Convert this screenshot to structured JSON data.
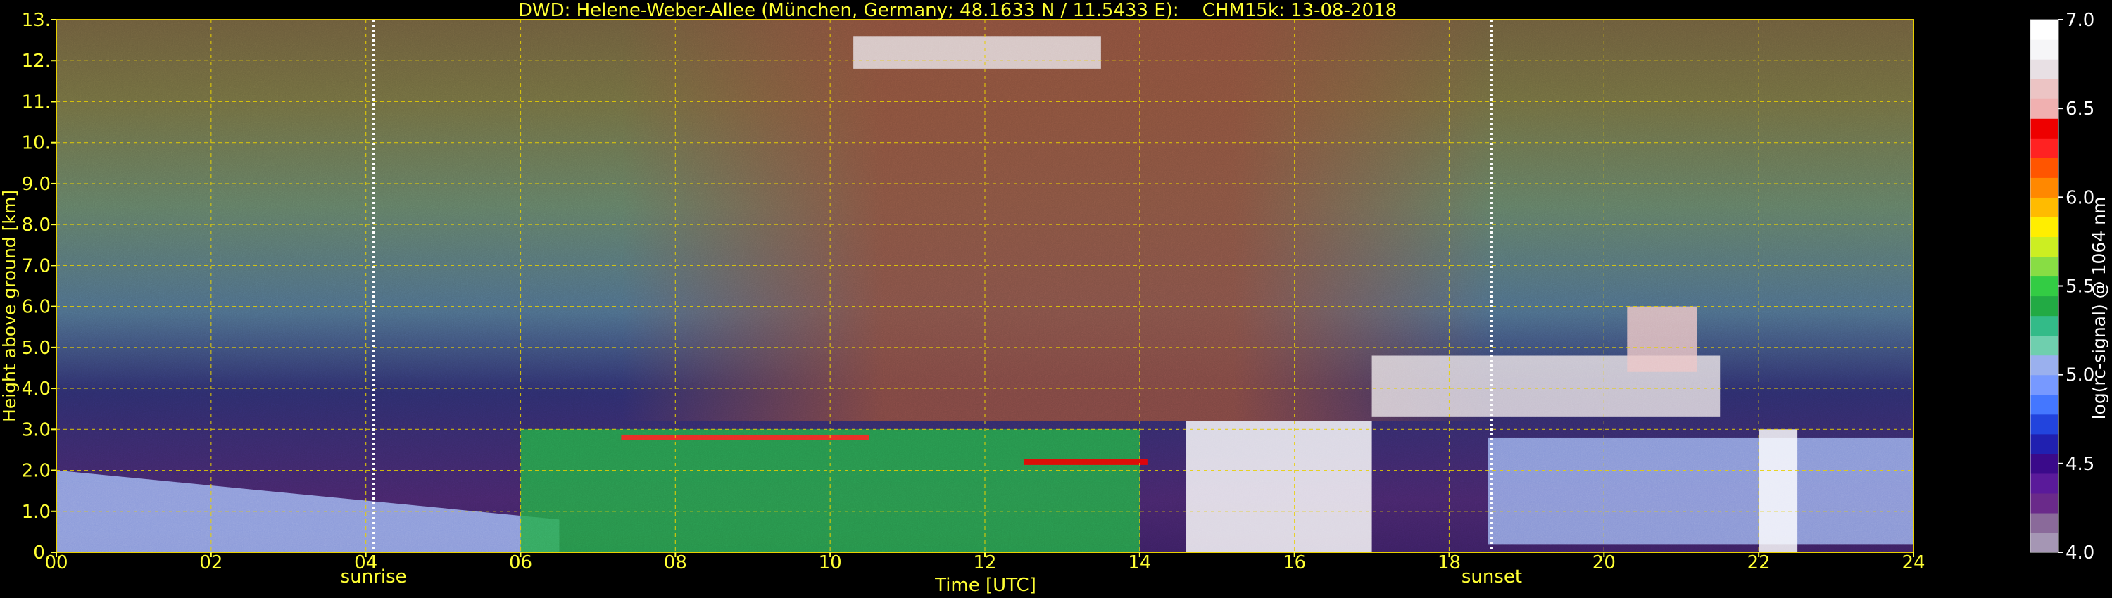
{
  "chart_data": {
    "type": "heatmap",
    "title": "DWD: Helene-Weber-Allee (München, Germany; 48.1633 N / 11.5433 E):    CHM15k: 13-08-2018",
    "xlabel": "Time [UTC]",
    "ylabel": "Height above ground [km]",
    "xlim": [
      0,
      24
    ],
    "ylim": [
      0,
      13
    ],
    "x_ticks": [
      0,
      2,
      4,
      6,
      8,
      10,
      12,
      14,
      16,
      18,
      20,
      22,
      24
    ],
    "x_tick_labels": [
      "00",
      "02",
      "04",
      "06",
      "08",
      "10",
      "12",
      "14",
      "16",
      "18",
      "20",
      "22",
      "24"
    ],
    "y_ticks": [
      0,
      1,
      2,
      3,
      4,
      5,
      6,
      7,
      8,
      9,
      10,
      11,
      12,
      13
    ],
    "y_tick_labels": [
      "0.",
      "1.0",
      "2.0",
      "3.0",
      "4.0",
      "5.0",
      "6.0",
      "7.0",
      "8.0",
      "9.0",
      "10.",
      "11.",
      "12.",
      "13."
    ],
    "grid": true,
    "markers": [
      {
        "label": "sunrise",
        "time": 4.1
      },
      {
        "label": "sunset",
        "time": 18.55
      }
    ],
    "colorbar": {
      "label": "log(rc-signal) @ 1064 nm",
      "range": [
        4.0,
        7.0
      ],
      "tick_values": [
        4.0,
        4.5,
        5.0,
        5.5,
        6.0,
        6.5,
        7.0
      ],
      "tick_labels": [
        "4.0",
        "4.5",
        "5.0",
        "5.5",
        "6.0",
        "6.5",
        "7.0"
      ],
      "colors": [
        "#a596b4",
        "#8a6a9a",
        "#6a2a8a",
        "#5a1a9a",
        "#3a0a8a",
        "#2020b0",
        "#2244dd",
        "#4477ff",
        "#7799ff",
        "#9ab0ee",
        "#6fcfae",
        "#33bb88",
        "#22aa44",
        "#33cc44",
        "#88dd44",
        "#ccee22",
        "#ffee00",
        "#ffbb00",
        "#ff8800",
        "#ff5500",
        "#ff2222",
        "#ee0000",
        "#f0b0b0",
        "#ecc4c4",
        "#e8e0e4",
        "#f6f6f8",
        "#ffffff"
      ]
    },
    "background_signal_profile": [
      {
        "height_km": 0.3,
        "value": 5.1
      },
      {
        "height_km": 1.5,
        "value": 4.6
      },
      {
        "height_km": 3.5,
        "value": 4.5
      },
      {
        "height_km": 6.0,
        "value": 4.9
      },
      {
        "height_km": 9.0,
        "value": 5.4
      },
      {
        "height_km": 12.5,
        "value": 5.6
      }
    ],
    "features": [
      {
        "name": "morning boundary layer",
        "start": 0,
        "end": 6.5,
        "top_km_start": 2.0,
        "top_km_end": 0.8,
        "value": 5.0
      },
      {
        "name": "mixing layer",
        "start": 6.0,
        "end": 14.0,
        "base_km": 0,
        "top_km": 3.0,
        "value": 5.4
      },
      {
        "name": "aerosol layer top",
        "start": 7.3,
        "end": 10.5,
        "height_km": 2.8,
        "value": 6.3
      },
      {
        "name": "cirrus",
        "start": 10.3,
        "end": 13.5,
        "base_km": 11.8,
        "top_km": 12.6,
        "value": 6.8
      },
      {
        "name": "cloud tops",
        "start": 12.5,
        "end": 14.1,
        "height_km": 2.2,
        "value": 6.4
      },
      {
        "name": "low cloud / precipitation",
        "start": 14.6,
        "end": 17.0,
        "base_km": 0,
        "top_km": 3.2,
        "value": 7.0
      },
      {
        "name": "mid-level cloud fragments",
        "start": 17.0,
        "end": 21.5,
        "base_km": 3.3,
        "top_km": 4.8,
        "value": 6.8
      },
      {
        "name": "evening residual layer",
        "start": 18.5,
        "end": 24,
        "base_km": 0.2,
        "top_km": 2.8,
        "value": 5.0
      },
      {
        "name": "cloud column",
        "start": 22.0,
        "end": 22.5,
        "base_km": 0,
        "top_km": 3.0,
        "value": 7.0
      },
      {
        "name": "high cloud fragments",
        "start": 20.3,
        "end": 21.2,
        "base_km": 4.4,
        "top_km": 6.0,
        "value": 6.6
      }
    ]
  }
}
